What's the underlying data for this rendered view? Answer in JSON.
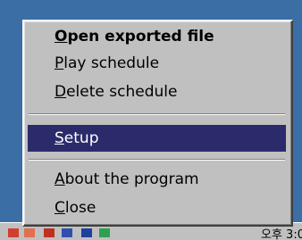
{
  "menu": {
    "items": [
      {
        "accel": "O",
        "rest": "pen exported file",
        "bold": true,
        "selected": false
      },
      {
        "accel": "P",
        "rest": "lay schedule",
        "bold": false,
        "selected": false
      },
      {
        "accel": "D",
        "rest": "elete schedule",
        "bold": false,
        "selected": false
      },
      {
        "accel": "S",
        "rest": "etup",
        "bold": false,
        "selected": true
      },
      {
        "accel": "A",
        "rest": "bout the program",
        "bold": false,
        "selected": false
      },
      {
        "accel": "C",
        "rest": "lose",
        "bold": false,
        "selected": false
      }
    ]
  },
  "tray": {
    "clock": "오후 3:0"
  },
  "colors": {
    "desktop": "#3a6ea5",
    "menu_bg": "#c0c0c0",
    "highlight": "#2b2b6b"
  }
}
